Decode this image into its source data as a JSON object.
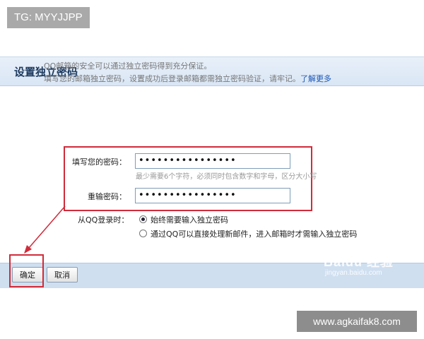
{
  "overlay": {
    "tag_text": "TG: MYYJJPP",
    "corner_text": "www.agkaifak8.com",
    "watermark_main": "Baidu 经验",
    "watermark_sub": "jingyan.baidu.com"
  },
  "dialog": {
    "title": "设置独立密码",
    "info_line1": "QQ邮箱的安全可以通过独立密码得到充分保证。",
    "info_line2": "填写您的邮箱独立密码，设置成功后登录邮箱都需独立密码验证，请牢记。",
    "learn_more": "了解更多",
    "password_label": "填写您的密码：",
    "password_value": "••••••••••••••••",
    "password_hint": "最少需要6个字符，必须同时包含数字和字母，区分大小写",
    "confirm_label": "重输密码：",
    "confirm_value": "••••••••••••••••",
    "login_label": "从QQ登录时：",
    "options": [
      {
        "label": "始终需要输入独立密码",
        "checked": true
      },
      {
        "label": "通过QQ可以直接处理新邮件，进入邮箱时才需输入独立密码",
        "checked": false
      }
    ],
    "ok_button": "确定",
    "cancel_button": "取消"
  },
  "colors": {
    "highlight": "#d12b3a",
    "header_bg": "#dce8f6",
    "footer_bg": "#cfdff0",
    "link": "#1a56b6"
  }
}
